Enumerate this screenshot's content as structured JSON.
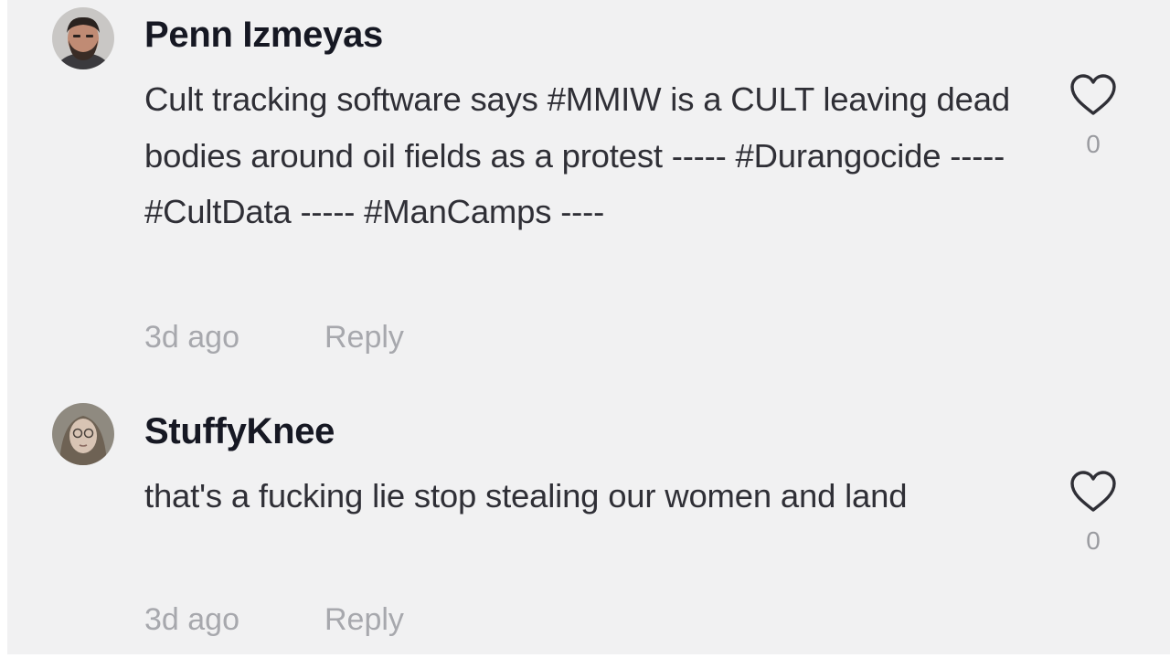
{
  "comments": [
    {
      "username": "Penn Izmeyas",
      "text": "Cult tracking software says #MMIW is a CULT leaving dead bodies around oil fields as a protest ----- #Durangocide ----- #CultData ----- #ManCamps ----",
      "time": "3d ago",
      "reply_label": "Reply",
      "likes": "0",
      "avatar_icon": "avatar-man-beard"
    },
    {
      "username": "StuffyKnee",
      "text": "that's a fucking lie stop stealing our women and land",
      "time": "3d ago",
      "reply_label": "Reply",
      "likes": "0",
      "avatar_icon": "avatar-woman-glasses"
    }
  ],
  "colors": {
    "background": "#f1f1f2",
    "username": "#161823",
    "text": "#2f2f36",
    "meta": "#a7a8ad"
  }
}
